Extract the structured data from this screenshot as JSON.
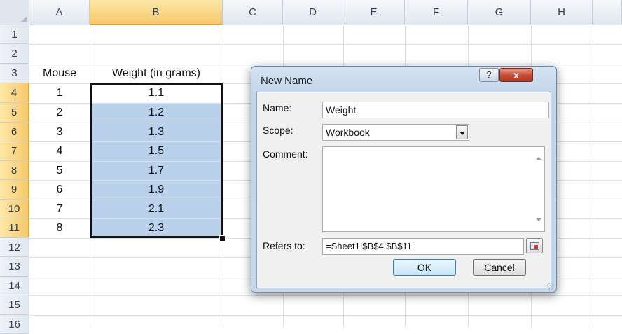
{
  "sheet": {
    "columns": [
      "A",
      "B",
      "C",
      "D",
      "E",
      "F",
      "G",
      "H"
    ],
    "rows": [
      "1",
      "2",
      "3",
      "4",
      "5",
      "6",
      "7",
      "8",
      "9",
      "10",
      "11",
      "12",
      "13",
      "14",
      "15",
      "16"
    ],
    "header_mouse": "Mouse",
    "header_weight": "Weight (in grams)",
    "mouse": [
      "1",
      "2",
      "3",
      "4",
      "5",
      "6",
      "7",
      "8"
    ],
    "weight": [
      "1.1",
      "1.2",
      "1.3",
      "1.5",
      "1.7",
      "1.9",
      "2.1",
      "2.3"
    ]
  },
  "dialog": {
    "title": "New Name",
    "help_icon": "?",
    "close_icon": "x",
    "name_label": "Name:",
    "name_value": "Weight",
    "scope_label": "Scope:",
    "scope_value": "Workbook",
    "comment_label": "Comment:",
    "comment_value": "",
    "refers_label": "Refers to:",
    "refers_value": "=Sheet1!$B$4:$B$11",
    "ok_label": "OK",
    "cancel_label": "Cancel"
  },
  "colors": {
    "selection_fill": "#b9d1ea",
    "header_highlight": "#f6c96c",
    "dialog_frame": "#c7d8ec",
    "close_button": "#c24a33"
  }
}
